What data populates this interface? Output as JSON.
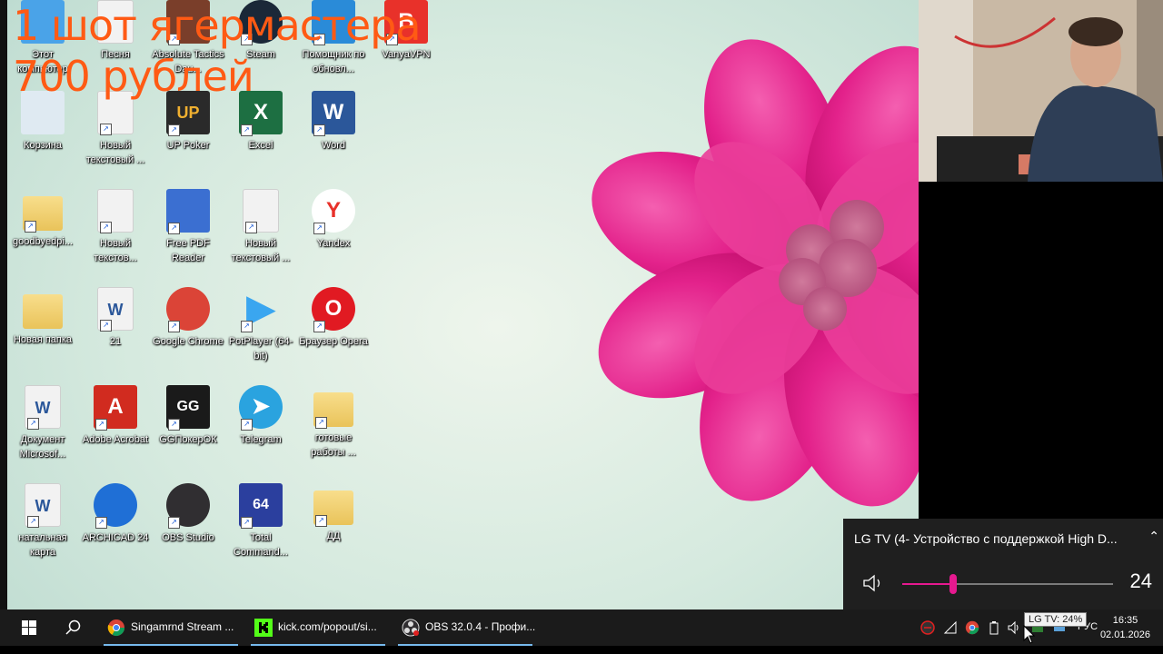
{
  "overlay": {
    "line1": "1 шот ягермастера",
    "line2": "700 рублей"
  },
  "desktop_icons": [
    {
      "label": "Этот компьютер",
      "icon": "pc-icon"
    },
    {
      "label": "Песня",
      "icon": "document-icon"
    },
    {
      "label": "Absolute Tactics Dau...",
      "icon": "game-icon"
    },
    {
      "label": "Steam",
      "icon": "steam-icon"
    },
    {
      "label": "Помощник по обновл...",
      "icon": "windows-icon"
    },
    {
      "label": "VanyaVPN",
      "icon": "vpn-icon"
    },
    {
      "label": "Корзина",
      "icon": "recycle-bin-icon"
    },
    {
      "label": "Новый текстовый ...",
      "icon": "text-file-icon"
    },
    {
      "label": "UP Poker",
      "icon": "up-poker-icon"
    },
    {
      "label": "Excel",
      "icon": "excel-icon"
    },
    {
      "label": "Word",
      "icon": "word-icon"
    },
    {
      "label": "goodbyedpi...",
      "icon": "folder-icon"
    },
    {
      "label": "Новый текстов...",
      "icon": "text-file-icon"
    },
    {
      "label": "Free PDF Reader",
      "icon": "pdf-reader-icon"
    },
    {
      "label": "Новый текстовый ...",
      "icon": "text-file-icon"
    },
    {
      "label": "Yandex",
      "icon": "yandex-icon"
    },
    {
      "label": "Новая папка",
      "icon": "folder-icon"
    },
    {
      "label": "21",
      "icon": "word-doc-icon"
    },
    {
      "label": "Google Chrome",
      "icon": "chrome-icon"
    },
    {
      "label": "PotPlayer (64-bit)",
      "icon": "potplayer-icon"
    },
    {
      "label": "Браузер Opera",
      "icon": "opera-icon"
    },
    {
      "label": "Документ Microsof...",
      "icon": "word-doc-icon"
    },
    {
      "label": "Adobe Acrobat",
      "icon": "acrobat-icon"
    },
    {
      "label": "GGПокерОК",
      "icon": "ggpokerok-icon"
    },
    {
      "label": "Telegram",
      "icon": "telegram-icon"
    },
    {
      "label": "готовые работы ...",
      "icon": "folder-icon"
    },
    {
      "label": "натальная карта",
      "icon": "word-doc-icon"
    },
    {
      "label": "ARCHICAD 24",
      "icon": "archicad-icon"
    },
    {
      "label": "OBS Studio",
      "icon": "obs-icon"
    },
    {
      "label": "Total Command...",
      "icon": "total-commander-icon"
    },
    {
      "label": "ДД",
      "icon": "folder-icon"
    }
  ],
  "volume_flyout": {
    "device": "LG TV (4- Устройство с поддержкой High D...",
    "level": 24
  },
  "taskbar": {
    "tasks": [
      {
        "label": "Singamrnd Stream ...",
        "icon": "chrome-icon"
      },
      {
        "label": "kick.com/popout/si...",
        "icon": "kick-icon"
      },
      {
        "label": "OBS 32.0.4 - Профи...",
        "icon": "obs-icon"
      }
    ],
    "tooltip": "LG TV: 24%",
    "lang": "РУС",
    "time": "16:35",
    "date": "02.01.2026"
  },
  "colors": {
    "accent": "#e6198f",
    "overlay_text": "#ff5a14",
    "taskbar": "#1b1b1b"
  }
}
